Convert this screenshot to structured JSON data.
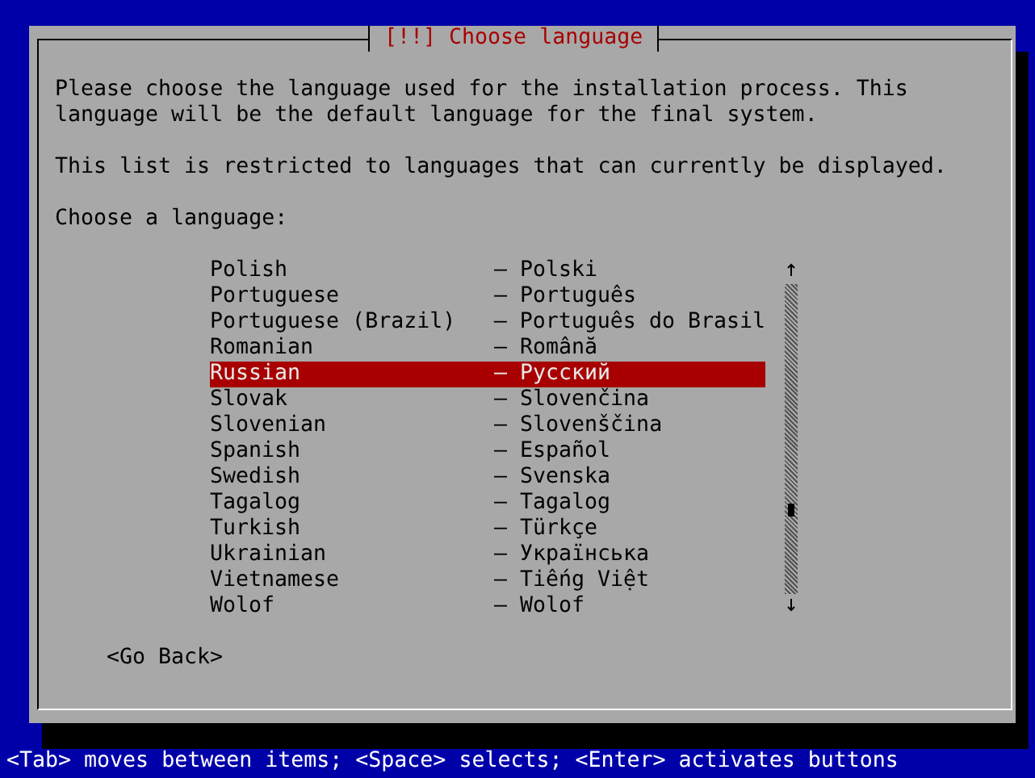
{
  "dialog": {
    "title": "[!!] Choose language",
    "paragraphs": [
      "Please choose the language used for the installation process. This language will be the default language for the final system.",
      "This list is restricted to languages that can currently be displayed."
    ],
    "prompt": "Choose a language:",
    "languages": [
      {
        "name": "Polish",
        "native": "– Polski",
        "selected": false
      },
      {
        "name": "Portuguese",
        "native": "– Português",
        "selected": false
      },
      {
        "name": "Portuguese (Brazil)",
        "native": "– Português do Brasil",
        "selected": false
      },
      {
        "name": "Romanian",
        "native": "– Română",
        "selected": false
      },
      {
        "name": "Russian",
        "native": "– Русский",
        "selected": true
      },
      {
        "name": "Slovak",
        "native": "– Slovenčina",
        "selected": false
      },
      {
        "name": "Slovenian",
        "native": "– Slovenščina",
        "selected": false
      },
      {
        "name": "Spanish",
        "native": "– Español",
        "selected": false
      },
      {
        "name": "Swedish",
        "native": "– Svenska",
        "selected": false
      },
      {
        "name": "Tagalog",
        "native": "– Tagalog",
        "selected": false
      },
      {
        "name": "Turkish",
        "native": "– Türkçe",
        "selected": false
      },
      {
        "name": "Ukrainian",
        "native": "– Українська",
        "selected": false
      },
      {
        "name": "Vietnamese",
        "native": "– Tiếng Việt",
        "selected": false
      },
      {
        "name": "Wolof",
        "native": "– Wolof",
        "selected": false
      }
    ],
    "buttons": [
      "<Go Back>"
    ]
  },
  "status_bar": "<Tab> moves between items; <Space> selects; <Enter> activates buttons"
}
